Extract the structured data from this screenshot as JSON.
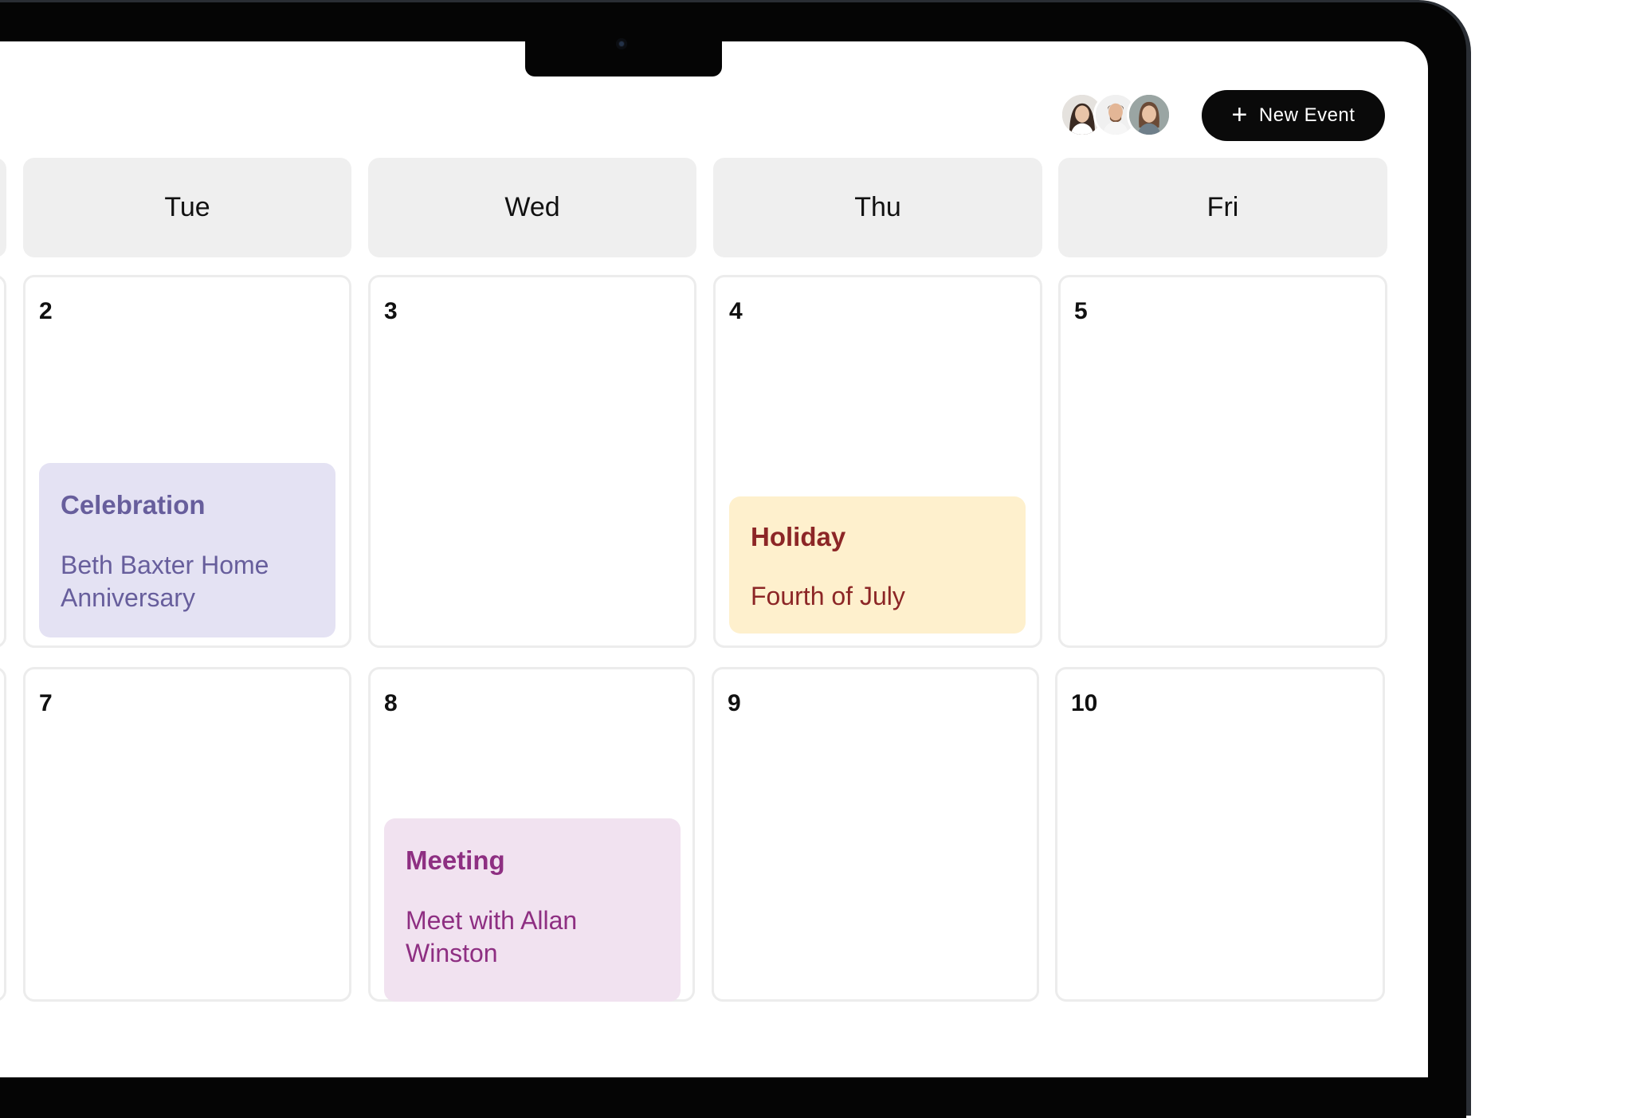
{
  "toolbar": {
    "new_event_label": "New Event",
    "plus_icon": "+"
  },
  "avatars": [
    {
      "name": "avatar-1",
      "bg": "#d9d9d9"
    },
    {
      "name": "avatar-2",
      "bg": "#e6e6e6"
    },
    {
      "name": "avatar-3",
      "bg": "#8e9a9a"
    }
  ],
  "days": [
    "Tue",
    "Wed",
    "Thu",
    "Fri"
  ],
  "weeks": [
    {
      "dates": [
        "2",
        "3",
        "4",
        "5"
      ]
    },
    {
      "dates": [
        "7",
        "8",
        "9",
        "10"
      ]
    }
  ],
  "events": {
    "celebration": {
      "title": "Celebration",
      "description": "Beth Baxter Home Anniversary",
      "color": "#675e9c",
      "bg": "#e4e2f3"
    },
    "holiday": {
      "title": "Holiday",
      "description": "Fourth of July",
      "color": "#8c2626",
      "bg": "#fef0cd"
    },
    "meeting": {
      "title": "Meeting",
      "description": "Meet with Allan Winston",
      "color": "#8e2f82",
      "bg": "#f1e2f0"
    }
  }
}
